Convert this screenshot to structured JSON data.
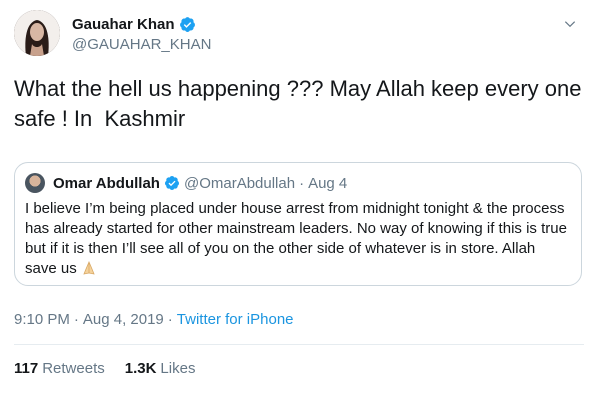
{
  "author": {
    "display_name": "Gauahar Khan",
    "handle": "@GAUAHAR_KHAN",
    "verified": true
  },
  "tweet": {
    "text": "What the hell us happening ??? May Allah keep every one safe ! In  Kashmir"
  },
  "quoted_tweet": {
    "display_name": "Omar Abdullah",
    "handle": "@OmarAbdullah",
    "separator": "·",
    "date": "Aug 4",
    "text": "I believe I’m being placed under house arrest from midnight tonight & the process has already started for other mainstream leaders. No way of knowing if this is true but if it is then I’ll see all of you on the other side of whatever is in store. Allah save us",
    "emoji": "folded-hands-icon"
  },
  "meta": {
    "time": "9:10 PM",
    "separator": "·",
    "date": "Aug 4, 2019",
    "source": "Twitter for iPhone"
  },
  "stats": {
    "retweets_count": "117",
    "retweets_label": "Retweets",
    "likes_count": "1.3K",
    "likes_label": "Likes"
  },
  "colors": {
    "text": "#14171a",
    "muted": "#657786",
    "link": "#1b95e0",
    "verified": "#1da1f2",
    "border": "#ccd6dd"
  }
}
